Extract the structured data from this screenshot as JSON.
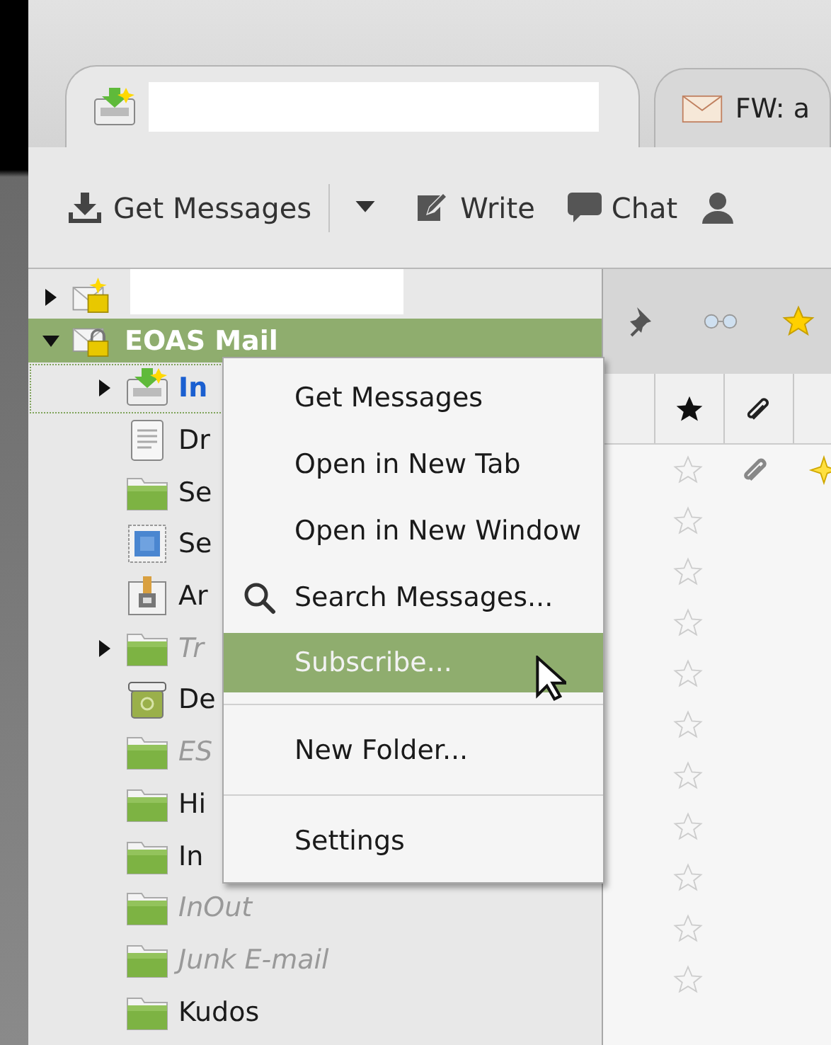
{
  "tabs": [
    {
      "kind": "folder",
      "selected": true,
      "redacted": true
    },
    {
      "kind": "message",
      "label": "FW: a",
      "selected": false
    }
  ],
  "toolbar": {
    "buttons": [
      {
        "kind": "get",
        "label": "Get Messages"
      },
      {
        "kind": "dropdown"
      },
      {
        "kind": "write",
        "label": "Write"
      },
      {
        "kind": "chat",
        "label": "Chat"
      },
      {
        "kind": "person"
      }
    ]
  },
  "folder_pane": {
    "accounts": [
      {
        "kind": "account-new",
        "redacted": true,
        "expanded": false,
        "selected": false
      },
      {
        "kind": "account-locked",
        "name": "EOAS Mail",
        "expanded": true,
        "selected": true,
        "children": [
          {
            "kind": "inbox",
            "name": "In",
            "unread": true,
            "dimmed": false,
            "focused": true,
            "expanded": false
          },
          {
            "kind": "drafts",
            "name": "Dr",
            "unread": false,
            "dimmed": false,
            "focused": false
          },
          {
            "kind": "folder",
            "name": "Se",
            "unread": false,
            "dimmed": false,
            "focused": false
          },
          {
            "kind": "templates",
            "name": "Se",
            "unread": false,
            "dimmed": false,
            "focused": false
          },
          {
            "kind": "archive",
            "name": "Ar",
            "unread": false,
            "dimmed": false,
            "focused": false
          },
          {
            "kind": "folder",
            "name": "Tr",
            "unread": false,
            "dimmed": true,
            "focused": false,
            "expanded": false
          },
          {
            "kind": "trash",
            "name": "De",
            "unread": false,
            "dimmed": false,
            "focused": false
          },
          {
            "kind": "folder",
            "name": "ES",
            "unread": false,
            "dimmed": true,
            "focused": false
          },
          {
            "kind": "folder",
            "name": "Hi",
            "unread": false,
            "dimmed": false,
            "focused": false
          },
          {
            "kind": "folder",
            "name": "In",
            "unread": false,
            "dimmed": false,
            "focused": false
          },
          {
            "kind": "folder",
            "name": "InOut",
            "unread": false,
            "dimmed": true,
            "focused": false
          },
          {
            "kind": "folder",
            "name": "Junk E-mail",
            "unread": false,
            "dimmed": true,
            "focused": false
          },
          {
            "kind": "folder",
            "name": "Kudos",
            "unread": false,
            "dimmed": false,
            "focused": false
          }
        ]
      }
    ]
  },
  "message_list": {
    "rows": [
      {
        "starred": false,
        "attachment": true,
        "new": true
      },
      {
        "starred": false,
        "attachment": false,
        "new": false
      },
      {
        "starred": false,
        "attachment": false,
        "new": false
      },
      {
        "starred": false,
        "attachment": false,
        "new": false
      },
      {
        "starred": false,
        "attachment": false,
        "new": false
      },
      {
        "starred": false,
        "attachment": false,
        "new": false
      },
      {
        "starred": false,
        "attachment": false,
        "new": false
      },
      {
        "starred": false,
        "attachment": false,
        "new": false
      },
      {
        "starred": false,
        "attachment": false,
        "new": false
      },
      {
        "starred": false,
        "attachment": false,
        "new": false
      },
      {
        "starred": false,
        "attachment": false,
        "new": false
      }
    ]
  },
  "context_menu": {
    "items": [
      {
        "kind": "item",
        "label": "Get Messages",
        "selected": false
      },
      {
        "kind": "item",
        "label": "Open in New Tab",
        "selected": false
      },
      {
        "kind": "item",
        "label": "Open in New Window",
        "selected": false
      },
      {
        "kind": "search",
        "label": "Search Messages...",
        "selected": false
      },
      {
        "kind": "item",
        "label": "Subscribe...",
        "selected": true
      },
      {
        "kind": "separator"
      },
      {
        "kind": "item",
        "label": "New Folder...",
        "selected": false
      },
      {
        "kind": "separator"
      },
      {
        "kind": "item",
        "label": "Settings",
        "selected": false
      }
    ]
  }
}
